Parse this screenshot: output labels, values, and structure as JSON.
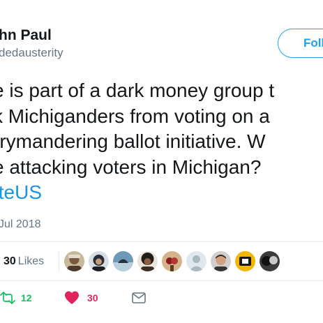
{
  "tweet": {
    "author_name": "hn Paul",
    "author_handle": "dedausterity",
    "follow_label": "Foll",
    "text_lines": [
      "e is part of a dark money group t",
      "k Michiganders from voting on a",
      "rrymandering ballot initiative. W",
      "e attacking voters in Michigan?"
    ],
    "mention": "tteUS",
    "date": "Jul 2018"
  },
  "stats": {
    "likes_count": "30",
    "likes_label": "Likes",
    "liker_avatar_count": 10
  },
  "actions": {
    "reply_count": "",
    "retweet_count": "12",
    "like_count": "30"
  },
  "colors": {
    "accent": "#1da1f2",
    "retweet": "#17bf63",
    "like": "#e0245e",
    "secondary_text": "#657786"
  },
  "icons": [
    "reply-icon",
    "retweet-icon",
    "heart-icon",
    "message-icon"
  ]
}
